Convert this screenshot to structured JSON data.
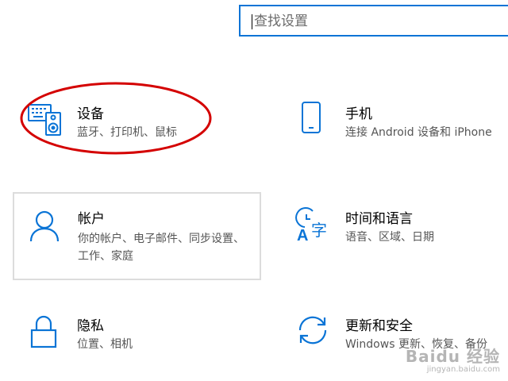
{
  "search": {
    "placeholder": "查找设置"
  },
  "tiles": [
    {
      "title": "设备",
      "description": "蓝牙、打印机、鼠标",
      "icon": "keyboard-speaker-icon"
    },
    {
      "title": "手机",
      "description": "连接 Android 设备和 iPhone",
      "icon": "phone-icon"
    },
    {
      "title": "帐户",
      "description": "你的帐户、电子邮件、同步设置、工作、家庭",
      "icon": "person-icon"
    },
    {
      "title": "时间和语言",
      "description": "语音、区域、日期",
      "icon": "time-language-icon"
    },
    {
      "title": "隐私",
      "description": "位置、相机",
      "icon": "lock-icon"
    },
    {
      "title": "更新和安全",
      "description": "Windows 更新、恢复、备份",
      "icon": "sync-arrows-icon"
    }
  ],
  "annotation": {
    "color": "#d40000",
    "target": "设备"
  },
  "watermark": {
    "logo": "Baidu 经验",
    "url": "jingyan.baidu.com"
  },
  "colors": {
    "accent": "#0a74d6",
    "hover_border": "#dcdcdc",
    "secondary_text": "#555555"
  }
}
